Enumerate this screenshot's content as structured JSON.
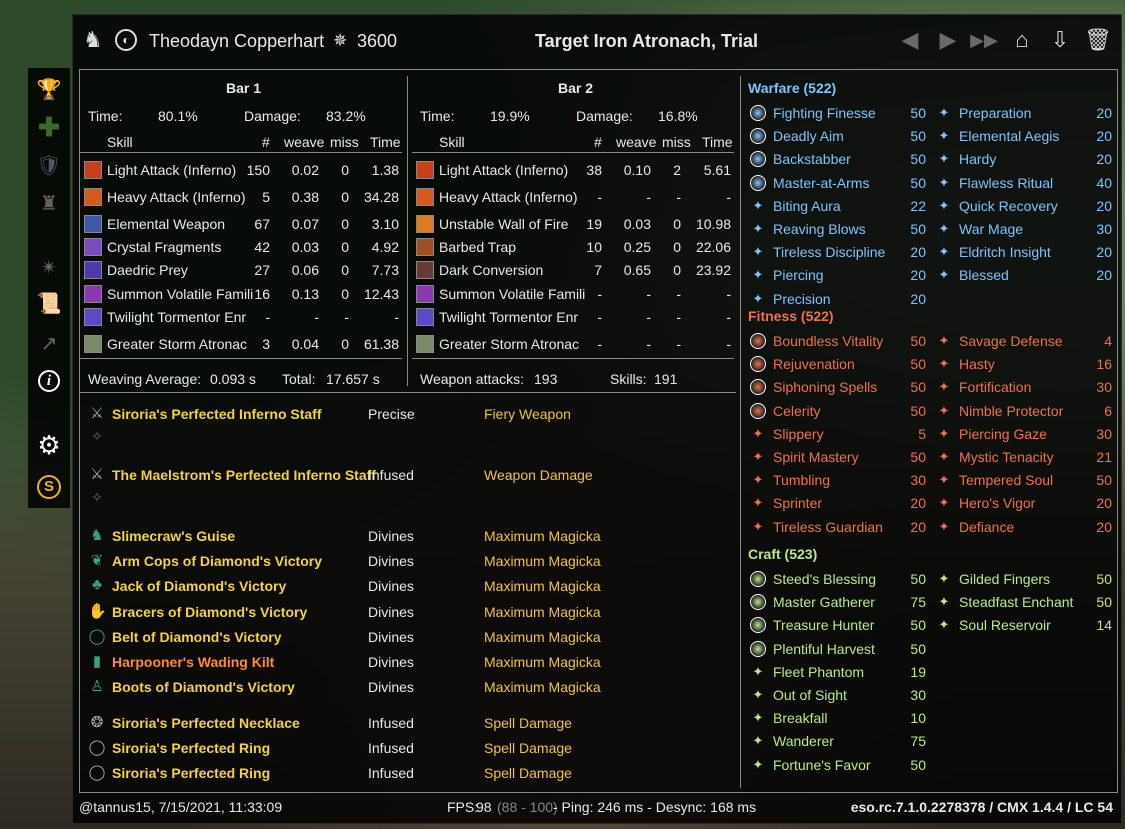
{
  "colors": {
    "warfare": "#7fc4ff",
    "fitness": "#f0704a",
    "craft": "#b7ea88",
    "set": "#f3d23b",
    "mythic": "#ff8a26"
  },
  "sidebar": {
    "icons": [
      "trophy-icon",
      "heal-icon",
      "shield-icon",
      "puzzle-icon",
      "spark-icon",
      "scroll-icon",
      "graph-icon",
      "info-icon",
      "gear-icon",
      "coin-icon"
    ]
  },
  "header": {
    "player": "Theodayn Copperhart",
    "cp": "3600",
    "target": "Target Iron Atronach, Trial"
  },
  "bar1": {
    "title": "Bar 1",
    "time_label": "Time:",
    "time": "80.1%",
    "damage_label": "Damage:",
    "damage": "83.2%",
    "cols": [
      "Skill",
      "#",
      "weave",
      "miss",
      "Time"
    ],
    "rows": [
      [
        "Light Attack (Inferno)",
        "150",
        "0.02",
        "0",
        "1.38"
      ],
      [
        "Heavy Attack (Inferno)",
        "5",
        "0.38",
        "0",
        "34.28"
      ],
      [
        "Elemental Weapon",
        "67",
        "0.07",
        "0",
        "3.10"
      ],
      [
        "Crystal Fragments",
        "42",
        "0.03",
        "0",
        "4.92"
      ],
      [
        "Daedric Prey",
        "27",
        "0.06",
        "0",
        "7.73"
      ],
      [
        "Summon Volatile Famili",
        "16",
        "0.13",
        "0",
        "12.43"
      ],
      [
        "Twilight Tormentor Enr",
        "-",
        "-",
        "-",
        "-"
      ],
      [
        "Greater Storm Atronac",
        "3",
        "0.04",
        "0",
        "61.38"
      ]
    ],
    "weave_label": "Weaving Average:",
    "weave_avg": "0.093 s",
    "total_label": "Total:",
    "total": "17.657 s"
  },
  "bar2": {
    "title": "Bar 2",
    "time_label": "Time:",
    "time": "19.9%",
    "damage_label": "Damage:",
    "damage": "16.8%",
    "cols": [
      "Skill",
      "#",
      "weave",
      "miss",
      "Time"
    ],
    "rows": [
      [
        "Light Attack (Inferno)",
        "38",
        "0.10",
        "2",
        "5.61"
      ],
      [
        "Heavy Attack (Inferno)",
        "-",
        "-",
        "-",
        "-"
      ],
      [
        "Unstable Wall of Fire",
        "19",
        "0.03",
        "0",
        "10.98"
      ],
      [
        "Barbed Trap",
        "10",
        "0.25",
        "0",
        "22.06"
      ],
      [
        "Dark Conversion",
        "7",
        "0.65",
        "0",
        "23.92"
      ],
      [
        "Summon Volatile Famili",
        "-",
        "-",
        "-",
        "-"
      ],
      [
        "Twilight Tormentor Enr",
        "-",
        "-",
        "-",
        "-"
      ],
      [
        "Greater Storm Atronac",
        "-",
        "-",
        "-",
        "-"
      ]
    ],
    "wa_label": "Weapon attacks:",
    "wa": "193",
    "skills_label": "Skills:",
    "skills": "191"
  },
  "gear": [
    {
      "name": "Siroria's Perfected Inferno Staff",
      "trait": "Precise",
      "enchant": "Fiery Weapon",
      "type": "set"
    },
    {
      "name": "The Maelstrom's Perfected Inferno Staff",
      "trait": "Infused",
      "enchant": "Weapon Damage",
      "type": "set"
    },
    {
      "name": "Slimecraw's Guise",
      "trait": "Divines",
      "enchant": "Maximum Magicka",
      "type": "set"
    },
    {
      "name": "Arm Cops of Diamond's Victory",
      "trait": "Divines",
      "enchant": "Maximum Magicka",
      "type": "set"
    },
    {
      "name": "Jack of Diamond's Victory",
      "trait": "Divines",
      "enchant": "Maximum Magicka",
      "type": "set"
    },
    {
      "name": "Bracers of Diamond's Victory",
      "trait": "Divines",
      "enchant": "Maximum Magicka",
      "type": "set"
    },
    {
      "name": "Belt of Diamond's Victory",
      "trait": "Divines",
      "enchant": "Maximum Magicka",
      "type": "set"
    },
    {
      "name": "Harpooner's Wading Kilt",
      "trait": "Divines",
      "enchant": "Maximum Magicka",
      "type": "mythic"
    },
    {
      "name": "Boots of Diamond's Victory",
      "trait": "Divines",
      "enchant": "Maximum Magicka",
      "type": "set"
    },
    {
      "name": "Siroria's Perfected Necklace",
      "trait": "Infused",
      "enchant": "Spell Damage",
      "type": "set"
    },
    {
      "name": "Siroria's Perfected Ring",
      "trait": "Infused",
      "enchant": "Spell Damage",
      "type": "set"
    },
    {
      "name": "Siroria's Perfected Ring",
      "trait": "Infused",
      "enchant": "Spell Damage",
      "type": "set"
    }
  ],
  "cp": {
    "warfare": {
      "title": "Warfare (522)",
      "left": [
        [
          "Fighting Finesse",
          "50",
          true
        ],
        [
          "Deadly Aim",
          "50",
          true
        ],
        [
          "Backstabber",
          "50",
          true
        ],
        [
          "Master-at-Arms",
          "50",
          true
        ],
        [
          "Biting Aura",
          "22",
          false
        ],
        [
          "Reaving Blows",
          "50",
          false
        ],
        [
          "Tireless Discipline",
          "20",
          false
        ],
        [
          "Piercing",
          "20",
          false
        ],
        [
          "Precision",
          "20",
          false
        ]
      ],
      "right": [
        [
          "Preparation",
          "20"
        ],
        [
          "Elemental Aegis",
          "20"
        ],
        [
          "Hardy",
          "20"
        ],
        [
          "Flawless Ritual",
          "40"
        ],
        [
          "Quick Recovery",
          "20"
        ],
        [
          "War Mage",
          "30"
        ],
        [
          "Eldritch Insight",
          "20"
        ],
        [
          "Blessed",
          "20"
        ]
      ]
    },
    "fitness": {
      "title": "Fitness (522)",
      "left": [
        [
          "Boundless Vitality",
          "50",
          true
        ],
        [
          "Rejuvenation",
          "50",
          true
        ],
        [
          "Siphoning Spells",
          "50",
          true
        ],
        [
          "Celerity",
          "50",
          true
        ],
        [
          "Slippery",
          "5",
          false
        ],
        [
          "Spirit Mastery",
          "50",
          false
        ],
        [
          "Tumbling",
          "30",
          false
        ],
        [
          "Sprinter",
          "20",
          false
        ],
        [
          "Tireless Guardian",
          "20",
          false
        ]
      ],
      "right": [
        [
          "Savage Defense",
          "4"
        ],
        [
          "Hasty",
          "16"
        ],
        [
          "Fortification",
          "30"
        ],
        [
          "Nimble Protector",
          "6"
        ],
        [
          "Piercing Gaze",
          "30"
        ],
        [
          "Mystic Tenacity",
          "21"
        ],
        [
          "Tempered Soul",
          "50"
        ],
        [
          "Hero's Vigor",
          "20"
        ],
        [
          "Defiance",
          "20"
        ]
      ]
    },
    "craft": {
      "title": "Craft (523)",
      "left": [
        [
          "Steed's Blessing",
          "50",
          true
        ],
        [
          "Master Gatherer",
          "75",
          true
        ],
        [
          "Treasure Hunter",
          "50",
          true
        ],
        [
          "Plentiful Harvest",
          "50",
          true
        ],
        [
          "Fleet Phantom",
          "19",
          false
        ],
        [
          "Out of Sight",
          "30",
          false
        ],
        [
          "Breakfall",
          "10",
          false
        ],
        [
          "Wanderer",
          "75",
          false
        ],
        [
          "Fortune's Favor",
          "50",
          false
        ]
      ],
      "right": [
        [
          "Gilded Fingers",
          "50"
        ],
        [
          "Steadfast Enchant",
          "50"
        ],
        [
          "Soul Reservoir",
          "14"
        ]
      ]
    }
  },
  "footer": {
    "user": "@tannus15, 7/15/2021, 11:33:09",
    "fps_label": "FPS:",
    "fps": "98",
    "fps_range": "(88 - 100)",
    "ping": "- Ping: 246 ms - Desync: 168 ms",
    "version": "eso.rc.7.1.0.2278378 / CMX 1.4.4 / LC 54"
  }
}
